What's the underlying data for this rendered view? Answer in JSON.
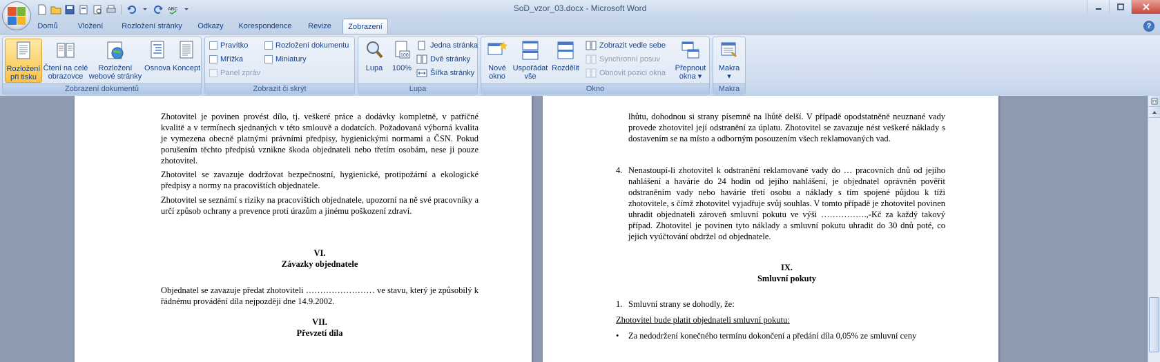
{
  "app": {
    "title": "SoD_vzor_03.docx - Microsoft Word"
  },
  "tabs": [
    "Domů",
    "Vložení",
    "Rozložení stránky",
    "Odkazy",
    "Korespondence",
    "Revize",
    "Zobrazení"
  ],
  "active_tab": "Zobrazení",
  "ribbon": {
    "views": {
      "label": "Zobrazení dokumentů",
      "print_layout": [
        "Rozložení",
        "při tisku"
      ],
      "full_screen": [
        "Čtení na celé",
        "obrazovce"
      ],
      "web_layout": [
        "Rozložení",
        "webové stránky"
      ],
      "outline": "Osnova",
      "draft": "Koncept"
    },
    "show_hide": {
      "label": "Zobrazit či skrýt",
      "ruler": "Pravítko",
      "gridlines": "Mřížka",
      "message_bar": "Panel zpráv",
      "doc_map": "Rozložení dokumentu",
      "thumbnails": "Miniatury"
    },
    "zoom": {
      "label": "Lupa",
      "zoom": "Lupa",
      "pct": "100%",
      "one_page": "Jedna stránka",
      "two_pages": "Dvě stránky",
      "page_width": "Šířka stránky"
    },
    "window": {
      "label": "Okno",
      "new": [
        "Nové",
        "okno"
      ],
      "arrange": [
        "Uspořádat",
        "vše"
      ],
      "split": "Rozdělit",
      "side_by_side": "Zobrazit vedle sebe",
      "sync_scroll": "Synchronní posuv",
      "reset_pos": "Obnovit pozici okna",
      "switch": [
        "Přepnout",
        "okna"
      ]
    },
    "macros": {
      "label": "Makra",
      "btn": "Makra"
    }
  },
  "doc": {
    "left": {
      "p1": "Zhotovitel je povinen provést dílo, tj. veškeré práce a dodávky kompletně, v patřičné kvalitě a v termínech sjednaných v této smlouvě a dodatcích. Požadovaná výborná kvalita je vymezena obecně platnými právními předpisy, hygienickými normami a ČSN. Pokud porušením těchto předpisů vznikne škoda objednateli nebo třetím osobám, nese ji pouze zhotovitel.",
      "p2": "Zhotovitel se zavazuje dodržovat bezpečnostní, hygienické, protipožární a ekologické předpisy a normy na pracovištích objednatele.",
      "p3": "Zhotovitel se seznámí s riziky na pracovištích objednatele, upozorní na ně své pracovníky a určí způsob ochrany a prevence proti úrazům a jinému poškození zdraví.",
      "h6_num": "VI.",
      "h6_title": "Závazky objednatele",
      "p4": "Objednatel se zavazuje  předat zhotoviteli …………………… ve stavu, který je způsobilý k řádnému  provádění díla nejpozději dne 14.9.2002.",
      "h7_num": "VII.",
      "h7_title": "Převzetí díla"
    },
    "right": {
      "p1": "lhůtu, dohodnou si strany písemně na lhůtě delší. V případě opodstatněně neuznané vady provede zhotovitel její odstranění za úplatu. Zhotovitel se zavazuje nést veškeré náklady s dostavením se na místo a odborným posouzením všech reklamovaných vad.",
      "item4_num": "4.",
      "item4": "Nenastoupí-li zhotovitel k odstranění reklamované vady do … pracovních dnů od jejího nahlášení a havárie do 24 hodin od jejího nahlášení, je objednatel oprávněn pověřit odstraněním vady nebo havárie  třetí osobu a náklady s tím spojené půjdou k tíži zhotovitele, s čímž zhotovitel vyjadřuje svůj souhlas. V tomto případě je zhotovitel povinen uhradit objednateli zároveň smluvní pokutu ve výši …………….,-Kč za každý takový případ. Zhotovitel je povinen tyto náklady a smluvní pokutu uhradit do 30 dnů poté, co jejich vyúčtování obdržel od objednatele.",
      "h9_num": "IX.",
      "h9_title": "Smluvní pokuty",
      "item1_num": "1.",
      "item1": "Smluvní strany se dohodly, že:",
      "underline": "Zhotovitel bude platit objednateli smluvní pokutu:",
      "bullet": "Za nedodržení konečného termínu dokončení a předání díla 0,05% ze smluvní ceny"
    }
  },
  "colors": {
    "accent": "#15428b",
    "active_btn": "#fbc34a",
    "close": "#c8453a"
  }
}
